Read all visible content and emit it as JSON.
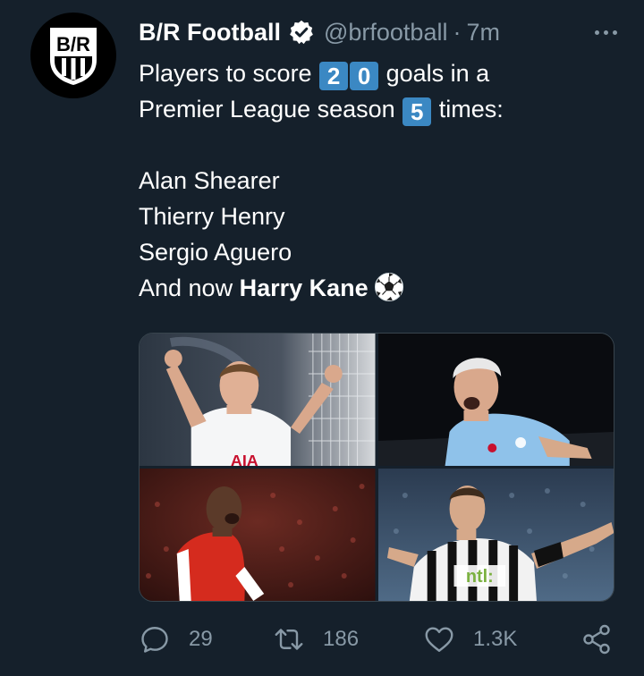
{
  "account": {
    "name": "B/R Football",
    "handle": "@brfootball",
    "separator": "·",
    "time": "7m",
    "avatar_text": "B/R",
    "verified": true
  },
  "tweet": {
    "line1_prefix": "Players to score",
    "keycap_1": "2",
    "keycap_2": "0",
    "line1_suffix": "goals in a",
    "line2_prefix": "Premier League season",
    "keycap_3": "5",
    "line2_suffix": "times:",
    "players": [
      "Alan Shearer",
      "Thierry Henry",
      "Sergio Aguero"
    ],
    "last_line_prefix": "And now",
    "last_line_name": "Harry Kane",
    "emoji_icon": "soccer-ball-icon"
  },
  "media": {
    "photos": [
      {
        "name": "photo-harry-kane",
        "shirt_text": "AIA"
      },
      {
        "name": "photo-sergio-aguero"
      },
      {
        "name": "photo-thierry-henry"
      },
      {
        "name": "photo-alan-shearer",
        "shirt_text": "ntl:"
      }
    ]
  },
  "actions": {
    "reply": {
      "icon": "reply-icon",
      "count": "29"
    },
    "retweet": {
      "icon": "retweet-icon",
      "count": "186"
    },
    "like": {
      "icon": "heart-icon",
      "count": "1.3K"
    },
    "share": {
      "icon": "share-icon"
    }
  },
  "colors": {
    "background": "#15202b",
    "text": "#ffffff",
    "muted": "#8899a6",
    "keycap": "#3b88c3",
    "border": "#38444d"
  }
}
